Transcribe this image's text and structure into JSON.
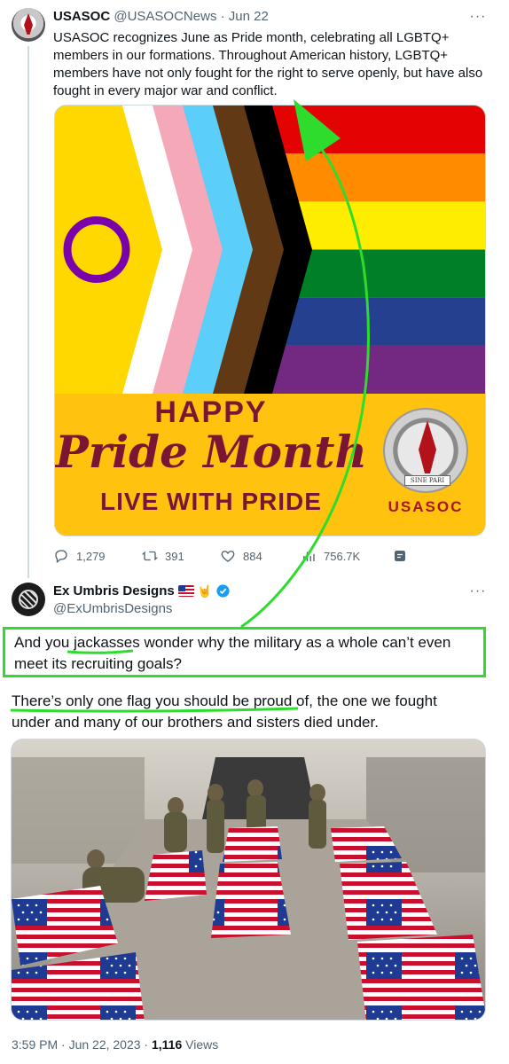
{
  "tweet1": {
    "display_name": "USASOC",
    "handle": "@USASOCNews",
    "separator": "·",
    "date": "Jun 22",
    "more_label": "···",
    "text": "USASOC recognizes June as Pride month, celebrating all LGBTQ+ members in our formations. Throughout American history, LGBTQ+ members have not only fought for the right to serve openly, but have also fought in every major war and conflict.",
    "image": {
      "happy": "HAPPY",
      "pride_month": "Pride Month",
      "live_with_pride": "LIVE WITH PRIDE",
      "seal_motto": "SINE PARI",
      "org": "USASOC"
    },
    "actions": {
      "replies": "1,279",
      "retweets": "391",
      "likes": "884",
      "views": "756.7K"
    }
  },
  "tweet2": {
    "display_name": "Ex Umbris Designs",
    "handle": "@ExUmbrisDesigns",
    "more_label": "···",
    "reply_before": "And you ",
    "reply_emph": "jackasses",
    "reply_after": " wonder why the military as a whole can’t even meet its recruiting goals?",
    "line2_emph": "There’s only one flag you should be proud of",
    "line2_after": ", the one we fought under and many of our brothers and sisters died under.",
    "footer_time": "3:59 PM · Jun 22, 2023 · ",
    "footer_views_num": "1,116",
    "footer_views_label": " Views"
  },
  "colors": {
    "highlight_green": "#2ddc2d",
    "pride_yellow": "#ffc20e",
    "pride_text": "#7a1533",
    "verified_blue": "#1d9bf0"
  }
}
